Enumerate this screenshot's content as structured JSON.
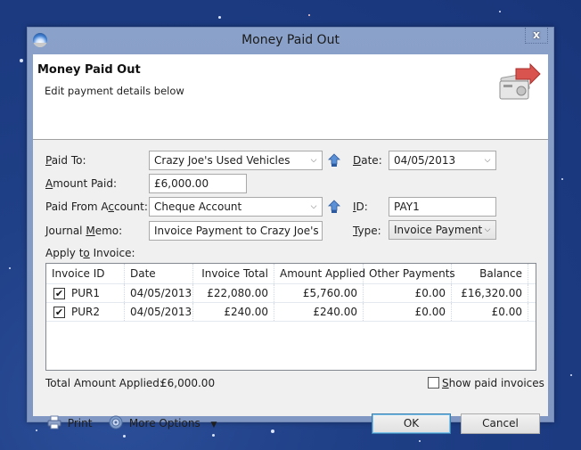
{
  "window": {
    "title": "Money Paid Out",
    "close_glyph": "x"
  },
  "header": {
    "title": "Money Paid Out",
    "subtitle": "Edit payment details below",
    "icon": "money-transfer-icon"
  },
  "form": {
    "paid_to": {
      "label_pre": "",
      "label_u": "P",
      "label_post": "aid To:",
      "value": "Crazy Joe's Used Vehicles"
    },
    "amount_paid": {
      "label_u": "A",
      "label_post": "mount Paid:",
      "value": "£6,000.00"
    },
    "paid_from": {
      "label_pre": "Paid From A",
      "label_u": "c",
      "label_post": "count:",
      "value": "Cheque Account"
    },
    "journal_memo": {
      "label_pre": "Journal ",
      "label_u": "M",
      "label_post": "emo:",
      "value": "Invoice Payment to Crazy Joe's Used Vehicles"
    },
    "apply_to_invoice": {
      "label_pre": "Apply t",
      "label_u": "o",
      "label_post": " Invoice:"
    },
    "date": {
      "label_u": "D",
      "label_post": "ate:",
      "value": "04/05/2013"
    },
    "id": {
      "label_u": "I",
      "label_post": "D:",
      "value": "PAY1"
    },
    "type": {
      "label_u": "T",
      "label_post": "ype:",
      "value": "Invoice Payment"
    }
  },
  "invoices": {
    "columns": [
      "Invoice ID",
      "Date",
      "Invoice Total",
      "Amount Applied",
      "Other Payments",
      "Balance"
    ],
    "rows": [
      {
        "checked": true,
        "id": "PUR1",
        "date": "04/05/2013",
        "total": "£22,080.00",
        "applied": "£5,760.00",
        "other": "£0.00",
        "balance": "£16,320.00"
      },
      {
        "checked": true,
        "id": "PUR2",
        "date": "04/05/2013",
        "total": "£240.00",
        "applied": "£240.00",
        "other": "£0.00",
        "balance": "£0.00"
      }
    ]
  },
  "summary": {
    "total_label": "Total Amount Applied:",
    "total_value": "£6,000.00",
    "show_paid": {
      "label_u": "S",
      "label_post": "how paid invoices",
      "checked": false
    }
  },
  "footer": {
    "print_label": "Print",
    "more_options_label": "More Options",
    "ok_label": "OK",
    "cancel_label": "Cancel"
  }
}
